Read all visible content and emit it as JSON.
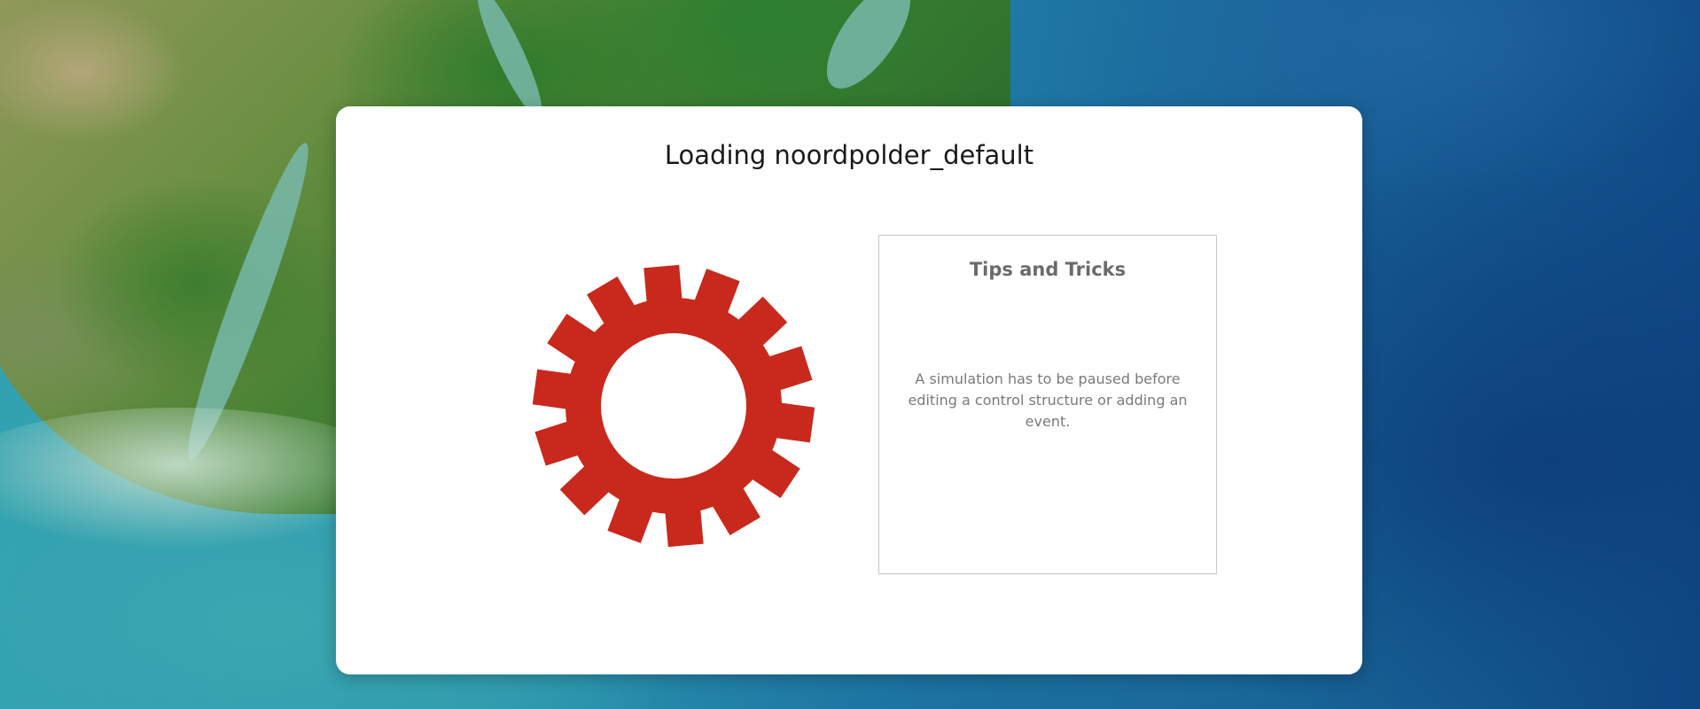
{
  "background": {
    "description_icon": "satellite-map-background"
  },
  "dialog": {
    "title": "Loading noordpolder_default",
    "spinner_icon": "gear-icon",
    "spinner_color": "#c8291c"
  },
  "tips": {
    "title": "Tips and Tricks",
    "text": "A simulation has to be paused before editing a control structure or adding an event."
  }
}
